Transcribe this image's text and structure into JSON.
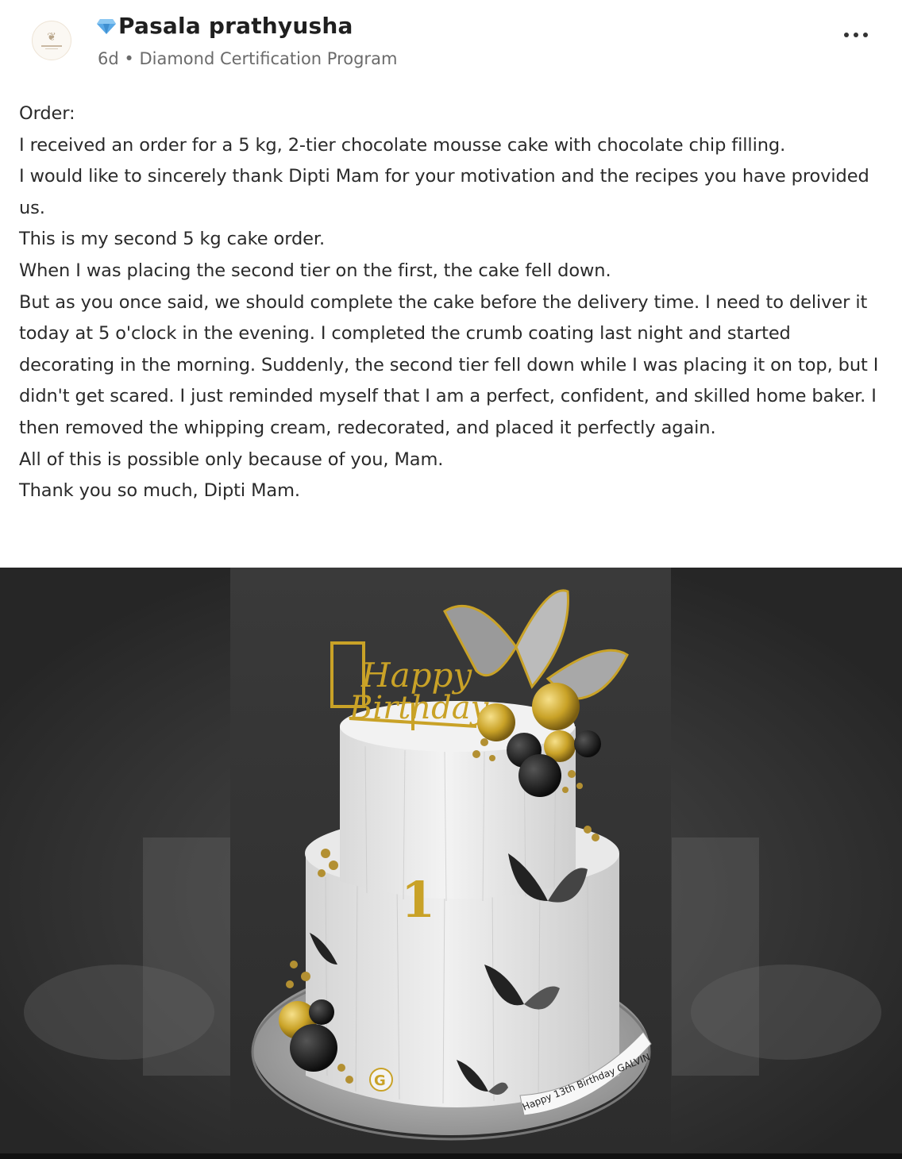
{
  "post": {
    "author": "Pasala prathyusha",
    "badge_icon": "diamond-icon",
    "time_ago": "6d",
    "separator": "•",
    "group": "Diamond Certification Program",
    "more_icon": "more-options-icon",
    "paragraphs": [
      "Order:",
      "I received an order for a 5 kg, 2-tier chocolate mousse cake with chocolate chip filling.",
      "I would like to sincerely thank Dipti Mam for your motivation and the recipes you have provided us.",
      "This is my second 5 kg cake order.",
      "When I was placing the second tier on the first, the cake fell down.",
      "But as you once said, we should complete the cake before the delivery time. I need to deliver it today at 5 o'clock in the evening. I completed the crumb coating last night and started decorating in the morning. Suddenly, the second tier fell down while I was placing it on top, but I didn't get scared. I just reminded myself that I am a perfect, confident, and skilled home baker. I then removed the whipping cream, redecorated, and placed it perfectly again.",
      "All of this is possible only because of you, Mam.",
      "Thank you so much, Dipti Mam."
    ]
  },
  "image": {
    "topper_text": "Happy Birthday",
    "number": "1",
    "initial": "G",
    "ribbon_text": "Happy 13th Birthday GALVIN"
  },
  "colors": {
    "diamond": "#5aa9e6",
    "gold": "#c9a227",
    "cake_white": "#eeeeee",
    "background_dark": "#2e2e2e"
  }
}
